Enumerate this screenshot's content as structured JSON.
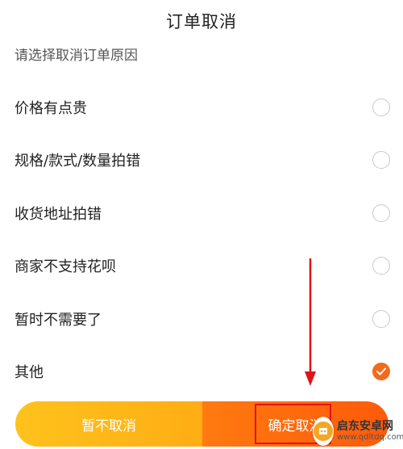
{
  "header": {
    "title": "订单取消"
  },
  "subtitle": "请选择取消订单原因",
  "reasons": [
    {
      "label": "价格有点贵",
      "checked": false
    },
    {
      "label": "规格/款式/数量拍错",
      "checked": false
    },
    {
      "label": "收货地址拍错",
      "checked": false
    },
    {
      "label": "商家不支持花呗",
      "checked": false
    },
    {
      "label": "暂时不需要了",
      "checked": false
    },
    {
      "label": "其他",
      "checked": true
    }
  ],
  "actions": {
    "cancel_label": "暂不取消",
    "confirm_label": "确定取消"
  },
  "watermark": {
    "name": "启东安卓网",
    "url": "www.qdltdq.com"
  },
  "colors": {
    "accent": "#f26b1d",
    "cancel_gradient": "#ffb81a",
    "confirm_gradient": "#ff6a0d",
    "annotation": "#e0121a"
  }
}
